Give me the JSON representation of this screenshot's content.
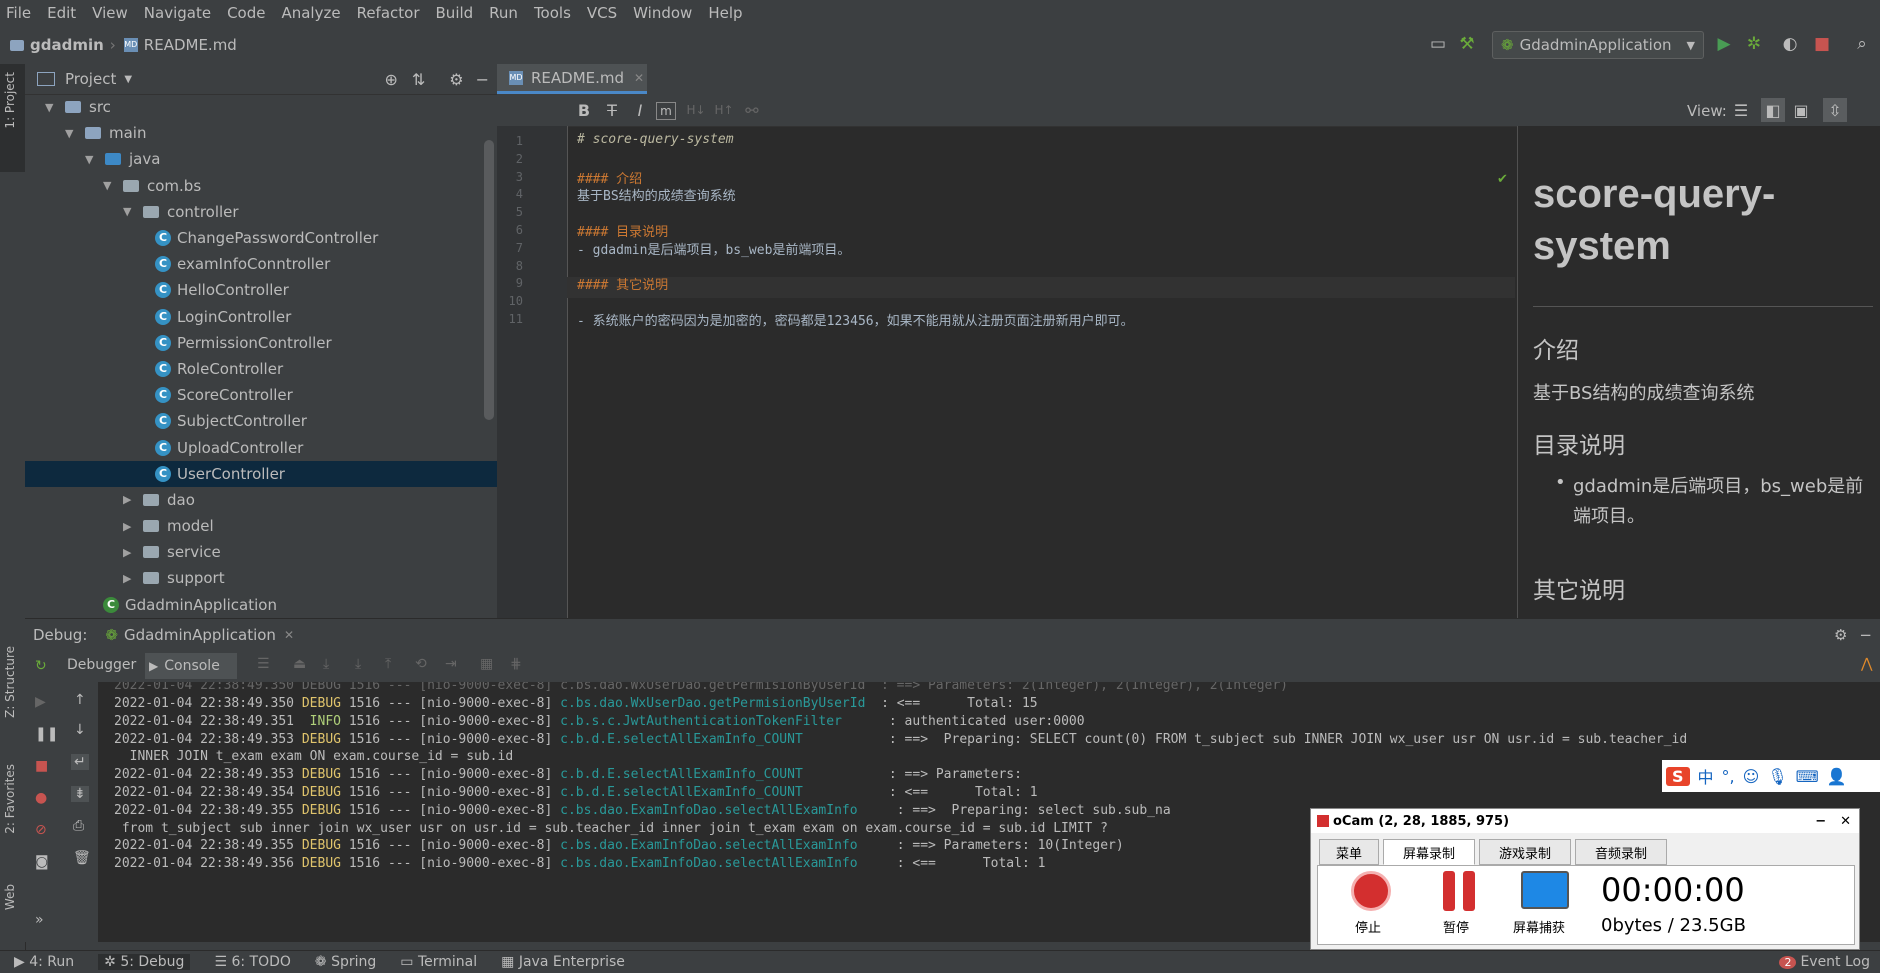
{
  "menu": [
    "File",
    "Edit",
    "View",
    "Navigate",
    "Code",
    "Analyze",
    "Refactor",
    "Build",
    "Run",
    "Tools",
    "VCS",
    "Window",
    "Help"
  ],
  "breadcrumb": {
    "project": "gdadmin",
    "file": "README.md"
  },
  "run_config": "GdadminApplication",
  "left_tabs": {
    "project": "1: Project",
    "structure": "Z: Structure",
    "favorites": "2: Favorites",
    "web": "Web"
  },
  "project_panel": {
    "title": "Project",
    "tree": [
      {
        "label": "src",
        "type": "folder",
        "open": true
      },
      {
        "label": "main",
        "type": "folder",
        "open": true
      },
      {
        "label": "java",
        "type": "folder-blue",
        "open": true
      },
      {
        "label": "com.bs",
        "type": "package",
        "open": true
      },
      {
        "label": "controller",
        "type": "package",
        "open": true
      },
      {
        "label": "ChangePasswordController",
        "type": "class"
      },
      {
        "label": "examInfoConntroller",
        "type": "class"
      },
      {
        "label": "HelloController",
        "type": "class"
      },
      {
        "label": "LoginController",
        "type": "class"
      },
      {
        "label": "PermissionController",
        "type": "class"
      },
      {
        "label": "RoleController",
        "type": "class"
      },
      {
        "label": "ScoreController",
        "type": "class"
      },
      {
        "label": "SubjectController",
        "type": "class"
      },
      {
        "label": "UploadController",
        "type": "class"
      },
      {
        "label": "UserController",
        "type": "class",
        "selected": true
      },
      {
        "label": "dao",
        "type": "package",
        "open": false
      },
      {
        "label": "model",
        "type": "package",
        "open": false
      },
      {
        "label": "service",
        "type": "package",
        "open": false
      },
      {
        "label": "support",
        "type": "package",
        "open": false
      },
      {
        "label": "GdadminApplication",
        "type": "class-app"
      }
    ]
  },
  "editor": {
    "tab": "README.md",
    "view_label": "View:",
    "lines": [
      {
        "n": "1",
        "text": "# score-query-system",
        "cls": "md-h1"
      },
      {
        "n": "2",
        "text": "",
        "cls": "md-p"
      },
      {
        "n": "3",
        "text": "#### 介绍",
        "cls": "md-h"
      },
      {
        "n": "4",
        "text": "基于BS结构的成绩查询系统",
        "cls": "md-p"
      },
      {
        "n": "5",
        "text": "",
        "cls": "md-p"
      },
      {
        "n": "6",
        "text": "#### 目录说明",
        "cls": "md-h"
      },
      {
        "n": "7",
        "text": "- gdadmin是后端项目，bs_web是前端项目。",
        "cls": "md-p"
      },
      {
        "n": "8",
        "text": "",
        "cls": "md-p"
      },
      {
        "n": "9",
        "text": "#### 其它说明",
        "cls": "md-h"
      },
      {
        "n": "10",
        "text": "",
        "cls": "md-p"
      },
      {
        "n": "11",
        "text": "- 系统账户的密码因为是加密的，密码都是123456，如果不能用就从注册页面注册新用户即可。",
        "cls": "md-p"
      }
    ],
    "preview": {
      "title": "score-query-system",
      "h_intro": "介绍",
      "p_intro": "基于BS结构的成绩查询系统",
      "h_dir": "目录说明",
      "li_dir": "gdadmin是后端项目，bs_web是前端项目。",
      "h_other": "其它说明"
    }
  },
  "debug": {
    "label": "Debug:",
    "config": "GdadminApplication",
    "tab_debugger": "Debugger",
    "tab_console": "Console",
    "log": [
      {
        "ts": "2022-01-04 22:38:49.350",
        "lvl": "DEBUG",
        "pid": "1516",
        "sep": "---",
        "thread": "[nio-9000-exec-8]",
        "logger": "c.bs.dao.WxUserDao.getPermisionByUserId ",
        "msg": ": <==      Total: 15"
      },
      {
        "ts": "2022-01-04 22:38:49.351",
        "lvl": " INFO",
        "pid": "1516",
        "sep": "---",
        "thread": "[nio-9000-exec-8]",
        "logger": "c.b.s.c.JwtAuthenticationTokenFilter     ",
        "msg": ": authenticated user:0000"
      },
      {
        "ts": "2022-01-04 22:38:49.353",
        "lvl": "DEBUG",
        "pid": "1516",
        "sep": "---",
        "thread": "[nio-9000-exec-8]",
        "logger": "c.b.d.E.selectAllExamInfo_COUNT          ",
        "msg": ": ==>  Preparing: SELECT count(0) FROM t_subject sub INNER JOIN wx_user usr ON usr.id = sub.teacher_id"
      },
      {
        "cont": "  INNER JOIN t_exam exam ON exam.course_id = sub.id"
      },
      {
        "ts": "2022-01-04 22:38:49.353",
        "lvl": "DEBUG",
        "pid": "1516",
        "sep": "---",
        "thread": "[nio-9000-exec-8]",
        "logger": "c.b.d.E.selectAllExamInfo_COUNT          ",
        "msg": ": ==> Parameters: "
      },
      {
        "ts": "2022-01-04 22:38:49.354",
        "lvl": "DEBUG",
        "pid": "1516",
        "sep": "---",
        "thread": "[nio-9000-exec-8]",
        "logger": "c.b.d.E.selectAllExamInfo_COUNT          ",
        "msg": ": <==      Total: 1"
      },
      {
        "ts": "2022-01-04 22:38:49.355",
        "lvl": "DEBUG",
        "pid": "1516",
        "sep": "---",
        "thread": "[nio-9000-exec-8]",
        "logger": "c.bs.dao.ExamInfoDao.selectAllExamInfo    ",
        "msg": ": ==>  Preparing: select sub.sub_na"
      },
      {
        "cont": " from t_subject sub inner join wx_user usr on usr.id = sub.teacher_id inner join t_exam exam on exam.course_id = sub.id LIMIT ?"
      },
      {
        "ts": "2022-01-04 22:38:49.355",
        "lvl": "DEBUG",
        "pid": "1516",
        "sep": "---",
        "thread": "[nio-9000-exec-8]",
        "logger": "c.bs.dao.ExamInfoDao.selectAllExamInfo    ",
        "msg": ": ==> Parameters: 10(Integer)"
      },
      {
        "ts": "2022-01-04 22:38:49.356",
        "lvl": "DEBUG",
        "pid": "1516",
        "sep": "---",
        "thread": "[nio-9000-exec-8]",
        "logger": "c.bs.dao.ExamInfoDao.selectAllExamInfo    ",
        "msg": ": <==      Total: 1"
      }
    ]
  },
  "bottom_tabs": [
    "4: Run",
    "5: Debug",
    "6: TODO",
    "Spring",
    "Terminal",
    "Java Enterprise"
  ],
  "event_log": {
    "count": "2",
    "label": "Event Log"
  },
  "ocam": {
    "title": "oCam (2, 28, 1885, 975)",
    "tabs": [
      "菜单",
      "屏幕录制",
      "游戏录制",
      "音频录制"
    ],
    "btn_stop": "停止",
    "btn_pause": "暂停",
    "btn_capture": "屏幕捕获",
    "time": "00:00:00",
    "size": "0bytes / 23.5GB"
  },
  "ime": {
    "logo": "S",
    "lang": "中"
  },
  "colors": {
    "accent": "#4a88c7",
    "selection": "#0d293e",
    "stop_red": "#d32f2f"
  }
}
